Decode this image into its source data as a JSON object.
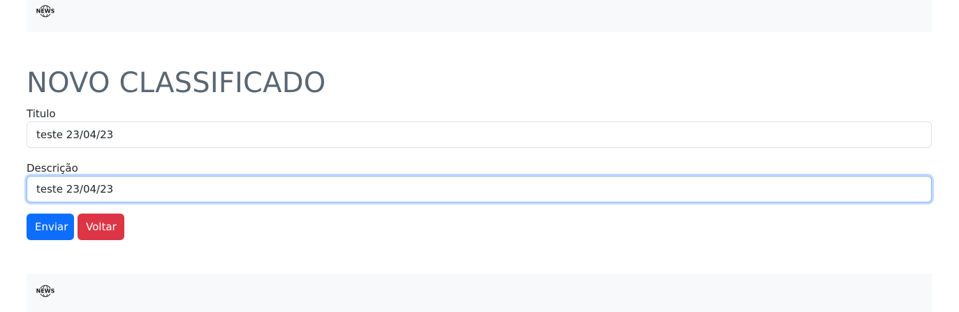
{
  "header": {
    "logo_icon": "news-globe-logo",
    "logo_text": "NEWS"
  },
  "page_title": "NOVO CLASSIFICADO",
  "form": {
    "titulo_label": "Titulo",
    "titulo_value": "teste 23/04/23",
    "descricao_label": "Descrição",
    "descricao_value": "teste 23/04/23",
    "submit_label": "Enviar",
    "back_label": "Voltar"
  },
  "footer": {
    "logo_icon": "news-globe-logo",
    "logo_text": "NEWS"
  },
  "colors": {
    "primary": "#0d6efd",
    "danger": "#dc3545",
    "bar_background": "#f8f9fa",
    "title": "#5a6773"
  }
}
